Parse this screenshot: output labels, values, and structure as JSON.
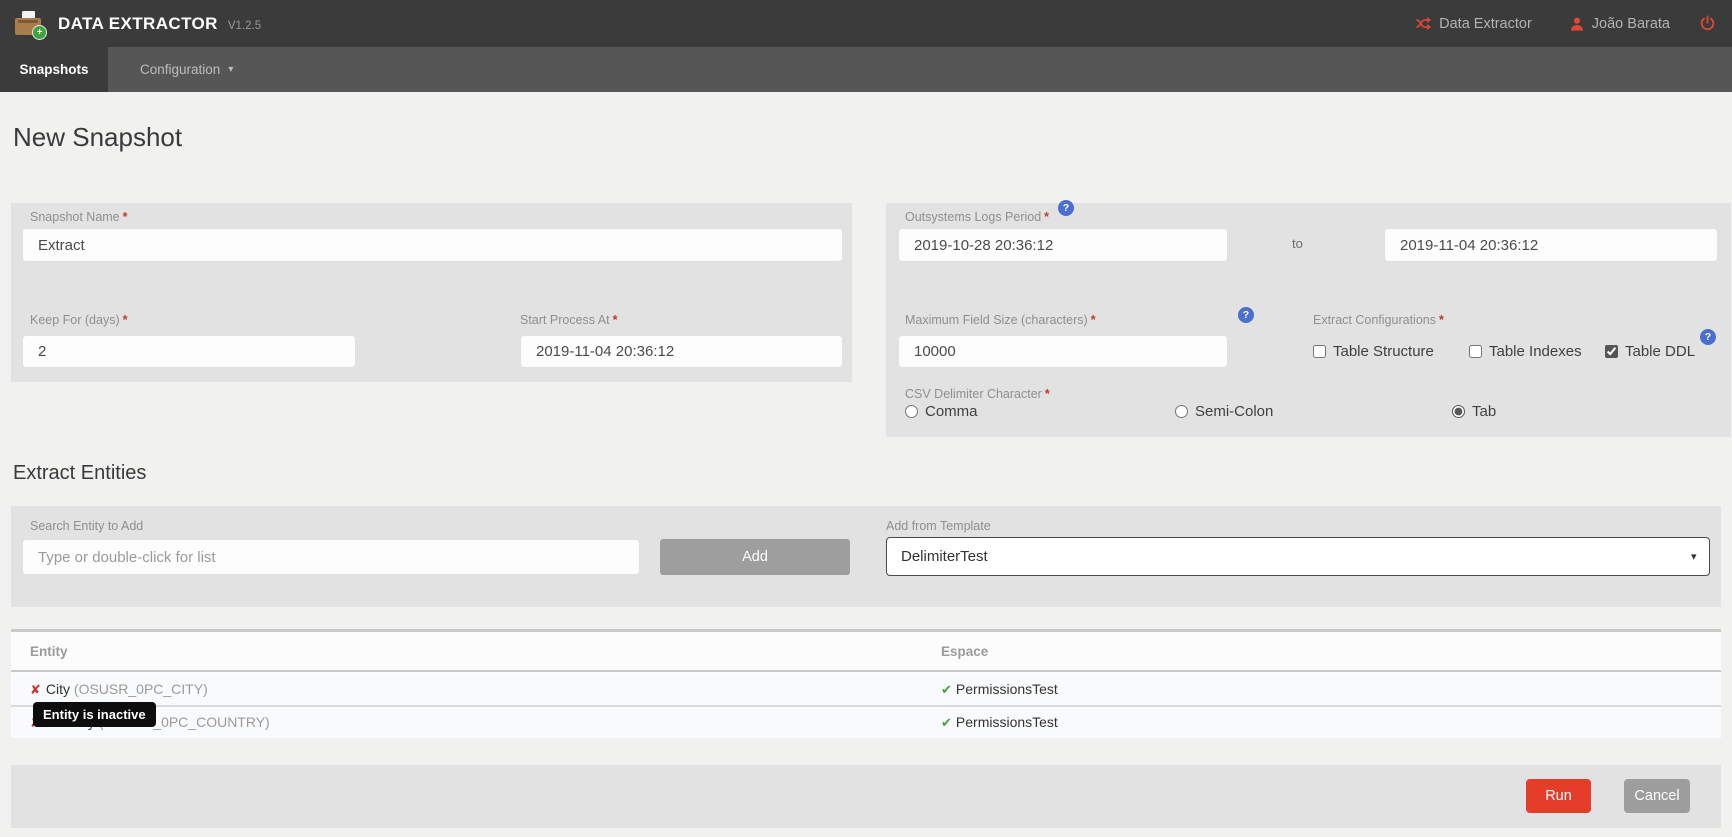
{
  "header": {
    "app_title": "DATA EXTRACTOR",
    "version": "V1.2.5",
    "env_link": "Data Extractor",
    "user_name": "João Barata"
  },
  "nav": {
    "tabs": [
      {
        "label": "Snapshots",
        "active": true
      },
      {
        "label": "Configuration",
        "active": false
      }
    ]
  },
  "page": {
    "title": "New Snapshot",
    "entities_title": "Extract Entities"
  },
  "icons": {
    "help": "?",
    "caret": "▾",
    "check": "✔",
    "cross": "✘",
    "required_marker": "*"
  },
  "form": {
    "snapshot_name": {
      "label": "Snapshot Name",
      "value": "Extract"
    },
    "keep_for": {
      "label": "Keep For (days)",
      "value": "2"
    },
    "start_process": {
      "label": "Start Process At",
      "value": "2019-11-04 20:36:12"
    },
    "logs_period": {
      "label": "Outsystems Logs Period",
      "from_value": "2019-10-28 20:36:12",
      "separator": "to",
      "to_value": "2019-11-04 20:36:12"
    },
    "max_field_size": {
      "label": "Maximum Field Size (characters)",
      "value": "10000"
    },
    "extract_configurations": {
      "label": "Extract Configurations",
      "options": [
        {
          "label": "Table Structure",
          "checked": false
        },
        {
          "label": "Table Indexes",
          "checked": false
        },
        {
          "label": "Table DDL",
          "checked": true
        }
      ]
    },
    "csv_delimiter": {
      "label": "CSV Delimiter Character",
      "options": [
        {
          "label": "Comma",
          "selected": false
        },
        {
          "label": "Semi-Colon",
          "selected": false
        },
        {
          "label": "Tab",
          "selected": true
        }
      ]
    }
  },
  "entities": {
    "search_label": "Search Entity to Add",
    "search_placeholder": "Type or double-click for list",
    "add_button": "Add",
    "template_label": "Add from Template",
    "template_value": "DelimiterTest",
    "tooltip": "Entity is inactive",
    "table": {
      "columns": [
        "Entity",
        "Espace"
      ],
      "rows": [
        {
          "name": "City",
          "code": "(OSUSR_0PC_CITY)",
          "espace": "PermissionsTest"
        },
        {
          "name": "Country",
          "code": "(OSUSR_0PC_COUNTRY)",
          "espace": "PermissionsTest"
        }
      ]
    }
  },
  "actions": {
    "run": "Run",
    "cancel": "Cancel"
  },
  "colors": {
    "accent_red": "#e04734",
    "run_red": "#e43d2a",
    "help_blue": "#4a6fce",
    "success_green": "#3fa33c",
    "error_red": "#cc342b",
    "topbar": "#3b3b3b",
    "navbar": "#565656",
    "panel": "#e2e2e2"
  }
}
